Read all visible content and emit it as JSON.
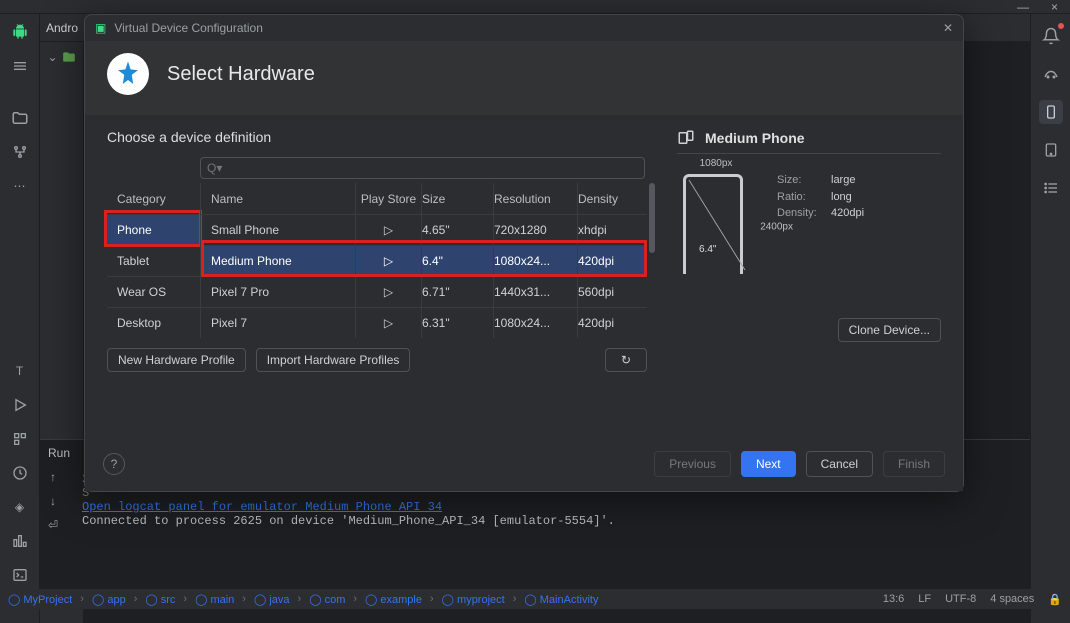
{
  "titlebar": {
    "min": "—",
    "close": "×"
  },
  "modal": {
    "title": "Virtual Device Configuration",
    "header": "Select Hardware",
    "section": "Choose a device definition",
    "search_label": "Q▾",
    "columns": {
      "category": "Category",
      "name": "Name",
      "play": "Play Store",
      "size": "Size",
      "res": "Resolution",
      "den": "Density"
    },
    "categories": [
      "Phone",
      "Tablet",
      "Wear OS",
      "Desktop"
    ],
    "selected_category_index": 0,
    "devices": [
      {
        "name": "Small Phone",
        "play": true,
        "size": "4.65\"",
        "res": "720x1280",
        "den": "xhdpi"
      },
      {
        "name": "Medium Phone",
        "play": true,
        "size": "6.4\"",
        "res": "1080x24...",
        "den": "420dpi"
      },
      {
        "name": "Pixel 7 Pro",
        "play": true,
        "size": "6.71\"",
        "res": "1440x31...",
        "den": "560dpi"
      },
      {
        "name": "Pixel 7",
        "play": true,
        "size": "6.31\"",
        "res": "1080x24...",
        "den": "420dpi"
      }
    ],
    "selected_device_index": 1,
    "buttons": {
      "new_profile": "New Hardware Profile",
      "import": "Import Hardware Profiles",
      "clone": "Clone Device..."
    },
    "preview": {
      "title": "Medium Phone",
      "width_label": "1080px",
      "height_label": "2400px",
      "diagonal": "6.4\"",
      "specs": [
        {
          "k": "Size:",
          "v": "large"
        },
        {
          "k": "Ratio:",
          "v": "long"
        },
        {
          "k": "Density:",
          "v": "420dpi"
        }
      ]
    },
    "footer": {
      "previous": "Previous",
      "next": "Next",
      "cancel": "Cancel",
      "finish": "Finish"
    }
  },
  "left_panel_label": "Andro",
  "run_label": "Run",
  "logcat": {
    "prefix": "2",
    "prefix2": "S",
    "link": "Open logcat panel for emulator Medium Phone API 34",
    "line2": "Connected to process 2625 on device 'Medium_Phone_API_34 [emulator-5554]'."
  },
  "breadcrumbs": [
    "MyProject",
    "app",
    "src",
    "main",
    "java",
    "com",
    "example",
    "myproject",
    "MainActivity"
  ],
  "status_right": [
    "13:6",
    "LF",
    "UTF-8",
    "4 spaces"
  ]
}
